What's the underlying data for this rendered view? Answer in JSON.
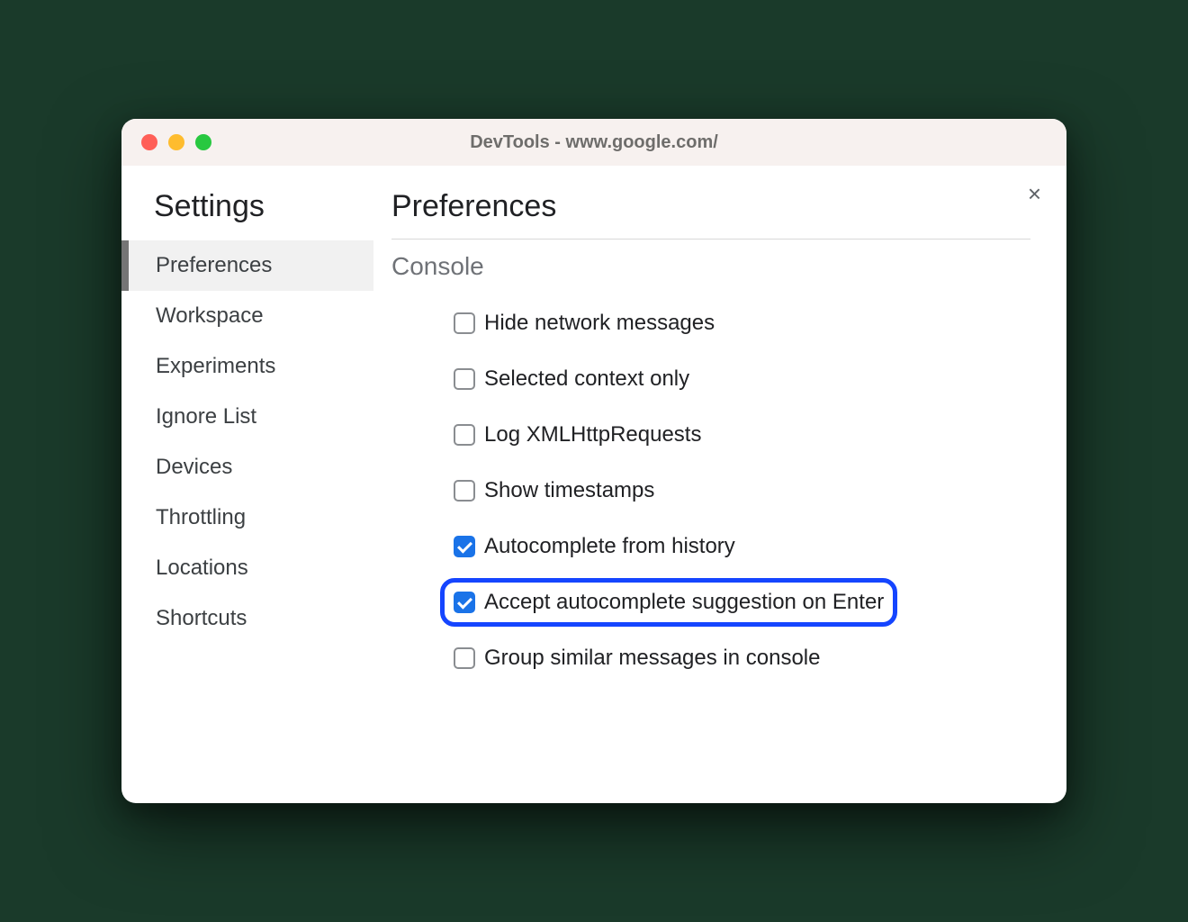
{
  "window": {
    "title": "DevTools - www.google.com/"
  },
  "sidebar": {
    "title": "Settings",
    "items": [
      {
        "label": "Preferences",
        "selected": true
      },
      {
        "label": "Workspace",
        "selected": false
      },
      {
        "label": "Experiments",
        "selected": false
      },
      {
        "label": "Ignore List",
        "selected": false
      },
      {
        "label": "Devices",
        "selected": false
      },
      {
        "label": "Throttling",
        "selected": false
      },
      {
        "label": "Locations",
        "selected": false
      },
      {
        "label": "Shortcuts",
        "selected": false
      }
    ]
  },
  "main": {
    "title": "Preferences",
    "section": "Console",
    "options": [
      {
        "label": "Hide network messages",
        "checked": false,
        "highlighted": false
      },
      {
        "label": "Selected context only",
        "checked": false,
        "highlighted": false
      },
      {
        "label": "Log XMLHttpRequests",
        "checked": false,
        "highlighted": false
      },
      {
        "label": "Show timestamps",
        "checked": false,
        "highlighted": false
      },
      {
        "label": "Autocomplete from history",
        "checked": true,
        "highlighted": false
      },
      {
        "label": "Accept autocomplete suggestion on Enter",
        "checked": true,
        "highlighted": true
      },
      {
        "label": "Group similar messages in console",
        "checked": false,
        "highlighted": false
      }
    ]
  },
  "colors": {
    "accent": "#1a73e8",
    "highlight": "#1545ff"
  }
}
